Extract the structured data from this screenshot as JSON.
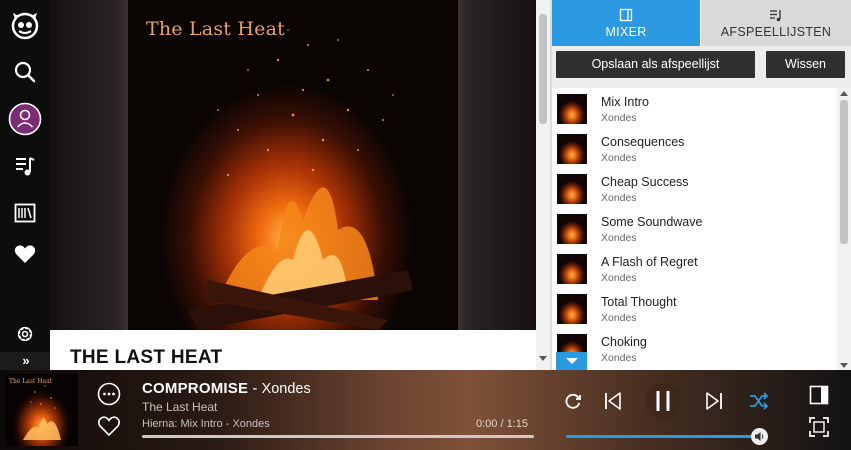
{
  "sidebar": {
    "items": [
      {
        "name": "napster-logo-icon"
      },
      {
        "name": "search-icon"
      },
      {
        "name": "profile-icon"
      },
      {
        "name": "music-library-icon"
      },
      {
        "name": "radio-icon"
      },
      {
        "name": "favorites-icon"
      },
      {
        "name": "settings-icon"
      }
    ],
    "expand_label": "»"
  },
  "main": {
    "cover_title": "The Last Heat",
    "album_heading": "THE LAST HEAT"
  },
  "panel": {
    "tabs": [
      {
        "label": "MIXER",
        "active": true
      },
      {
        "label": "AFSPEELLIJSTEN",
        "active": false
      }
    ],
    "save_button": "Opslaan als afspeellijst",
    "clear_button": "Wissen",
    "queue": [
      {
        "title": "Mix Intro",
        "artist": "Xondes"
      },
      {
        "title": "Consequences",
        "artist": "Xondes"
      },
      {
        "title": "Cheap Success",
        "artist": "Xondes"
      },
      {
        "title": "Some Soundwave",
        "artist": "Xondes"
      },
      {
        "title": "A Flash of Regret",
        "artist": "Xondes"
      },
      {
        "title": "Total Thought",
        "artist": "Xondes"
      },
      {
        "title": "Choking",
        "artist": "Xondes"
      }
    ]
  },
  "player": {
    "cover_title": "The Last Heat",
    "track_title": "COMPROMISE",
    "separator": " - ",
    "track_artist": "Xondes",
    "album": "The Last Heat",
    "up_next": "Hierna: Mix Intro - Xondes",
    "time": "0:00 / 1:15",
    "progress": 0,
    "volume": 1.0
  },
  "colors": {
    "accent": "#2c9ae2",
    "sidebar_bg": "#0d0d0d",
    "profile_ring": "#7b2d73"
  }
}
